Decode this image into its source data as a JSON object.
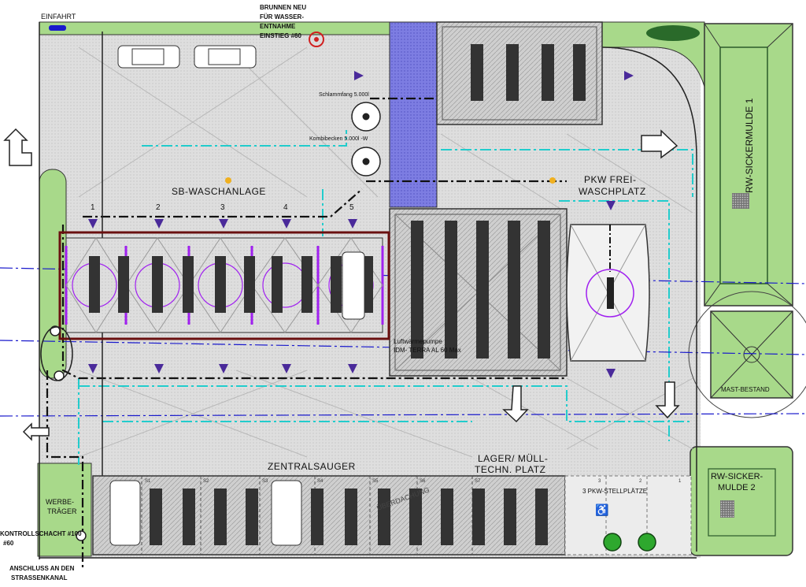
{
  "labels": {
    "einfahrt": "EINFAHRT",
    "brunnen_1": "BRUNNEN NEU",
    "brunnen_2": "FÜR WASSER-",
    "brunnen_3": "ENTNAHME",
    "brunnen_4": "EINSTIEG #60",
    "schlammfang": "Schlammfang 5.000l",
    "kombibecken": "Kombibecken 5.000l -W",
    "sb_waschanlage": "SB-WASCHANLAGE",
    "bay_numbers": [
      "1",
      "2",
      "3",
      "4",
      "5"
    ],
    "pkw_frei_1": "PKW FREI-",
    "pkw_frei_2": "WASCHPLATZ",
    "sickermulde_1": "RW-SICKERMULDE 1",
    "sickermulde_2a": "RW-SICKER-",
    "sickermulde_2b": "MULDE 2",
    "mast_bestand": "MAST-BESTAND",
    "luftwaerme_1": "Luftwärmepumpe",
    "luftwaerme_2": "IDM- TERRA AL 60 Max",
    "zentralsauger": "ZENTRALSAUGER",
    "lager_1": "LAGER/ MÜLL-",
    "lager_2": "TECHN. PLATZ",
    "stellplaetze": "3 PKW-STELLPLÄTZE",
    "ueberdachung": "ÜBERDACHUNG",
    "werbe_1": "WERBE-",
    "werbe_2": "TRÄGER",
    "kontroll_1": "KONTROLLSCHACHT #100",
    "kontroll_2": "#60",
    "anschluss_1": "ANSCHLUSS AN DEN",
    "anschluss_2": "STRASSENKANAL",
    "vac_numbers": [
      "S1",
      "S2",
      "S3",
      "S4",
      "S5",
      "S6",
      "S7"
    ],
    "parking_numbers": [
      "3",
      "2",
      "1"
    ]
  },
  "colors": {
    "paving": "#dcdcdc",
    "green": "#a8d98a",
    "green_dark": "#2a7a2a",
    "water_blue": "#6a6ad8",
    "cyan_line": "#22cccc",
    "purple": "#4a2a9a",
    "magenta": "#a020f0",
    "wash_frame": "#6a1010"
  }
}
